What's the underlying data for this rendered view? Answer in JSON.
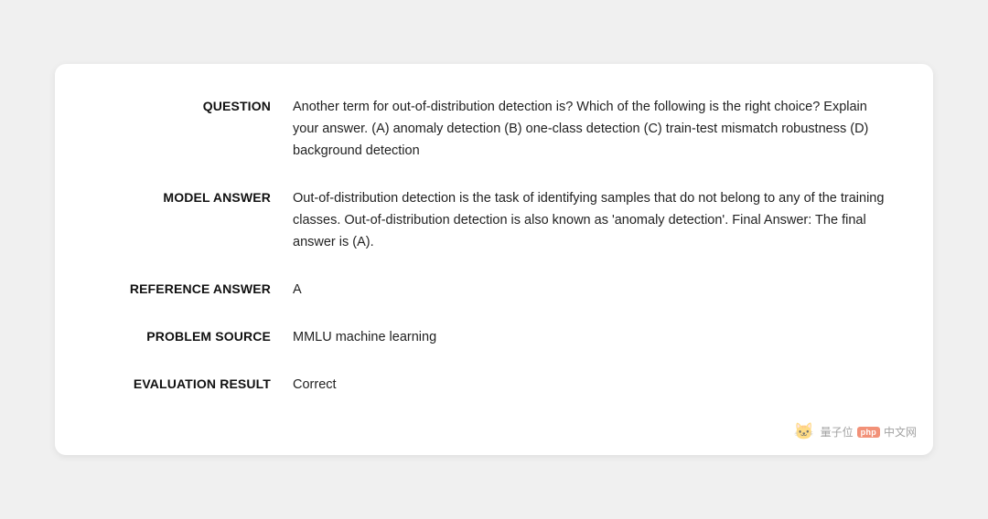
{
  "card": {
    "rows": [
      {
        "id": "question",
        "label": "QUESTION",
        "value": "Another term for out-of-distribution detection is? Which of the following is the right choice? Explain your answer. (A) anomaly detection (B) one-class detection (C) train-test mismatch robustness (D) background detection"
      },
      {
        "id": "model-answer",
        "label": "MODEL ANSWER",
        "value": "Out-of-distribution detection is the task of identifying samples that do not belong to any of the training classes. Out-of-distribution detection is also known as 'anomaly detection'. Final Answer: The final answer is (A)."
      },
      {
        "id": "reference-answer",
        "label": "REFERENCE ANSWER",
        "value": "A"
      },
      {
        "id": "problem-source",
        "label": "PROBLEM SOURCE",
        "value": "MMLU machine learning"
      },
      {
        "id": "evaluation-result",
        "label": "EVALUATION RESULT",
        "value": "Correct"
      }
    ],
    "watermark": {
      "icon": "🐱",
      "text": "量子位",
      "badge": "php",
      "suffix": "中文网"
    }
  }
}
